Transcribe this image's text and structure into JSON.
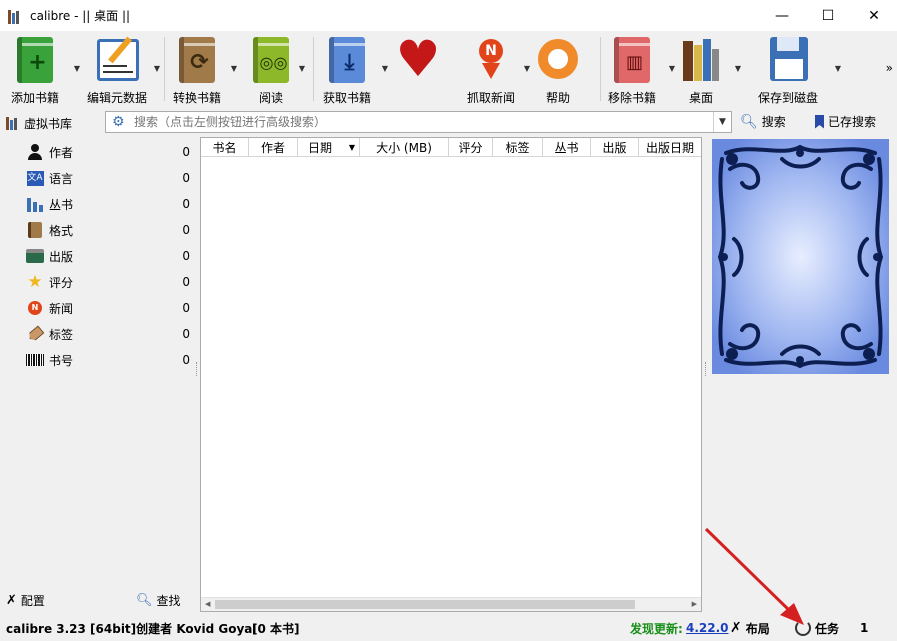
{
  "window": {
    "title": "calibre - || 桌面 ||",
    "controls": [
      "—",
      "☐",
      "✕"
    ]
  },
  "toolbar": {
    "items": [
      {
        "label": "添加书籍",
        "icon": "add-book-icon",
        "color": "#3aa23a",
        "glyph": "+"
      },
      {
        "label": "编辑元数据",
        "icon": "edit-metadata-icon",
        "color": "#3b6fb6",
        "glyph": "✎"
      },
      {
        "label": "转换书籍",
        "icon": "convert-book-icon",
        "color": "#8a6a3a",
        "glyph": "⟳"
      },
      {
        "label": "阅读",
        "icon": "read-book-icon",
        "color": "#7fb02a",
        "glyph": "∞"
      },
      {
        "label": "获取书籍",
        "icon": "get-books-icon",
        "color": "#4a7fd0",
        "glyph": "⤓"
      },
      {
        "label": "",
        "icon": "heart-icon",
        "color": "#c41818",
        "glyph": "♥"
      },
      {
        "label": "抓取新闻",
        "icon": "fetch-news-icon",
        "color": "#e04418",
        "glyph": "N"
      },
      {
        "label": "帮助",
        "icon": "help-icon",
        "color": "#f08a2a",
        "glyph": "◎"
      },
      {
        "label": "移除书籍",
        "icon": "remove-book-icon",
        "color": "#d84848",
        "glyph": "🗑"
      },
      {
        "label": "桌面",
        "icon": "library-icon",
        "color": "#8a4a2a",
        "glyph": "▮"
      },
      {
        "label": "保存到磁盘",
        "icon": "save-disk-icon",
        "color": "#3b6fb6",
        "glyph": "💾"
      }
    ],
    "more": "»"
  },
  "searchbar": {
    "virtual_library": "虚拟书库",
    "placeholder": "搜索（点击左侧按钮进行高级搜索）",
    "search_button": "搜索",
    "saved_search_button": "已存搜索"
  },
  "tag_browser": {
    "items": [
      {
        "label": "作者",
        "count": "0",
        "icon": "author-icon"
      },
      {
        "label": "语言",
        "count": "0",
        "icon": "language-icon"
      },
      {
        "label": "丛书",
        "count": "0",
        "icon": "series-icon"
      },
      {
        "label": "格式",
        "count": "0",
        "icon": "format-icon"
      },
      {
        "label": "出版",
        "count": "0",
        "icon": "publisher-icon"
      },
      {
        "label": "评分",
        "count": "0",
        "icon": "rating-icon"
      },
      {
        "label": "新闻",
        "count": "0",
        "icon": "news-icon"
      },
      {
        "label": "标签",
        "count": "0",
        "icon": "tag-icon"
      },
      {
        "label": "书号",
        "count": "0",
        "icon": "identifier-icon"
      }
    ],
    "configure": "配置",
    "find": "查找"
  },
  "book_list": {
    "columns": [
      "书名",
      "作者",
      "日期",
      "大小 (MB)",
      "评分",
      "标签",
      "丛书",
      "出版",
      "出版日期"
    ]
  },
  "statusbar": {
    "version": "calibre 3.23 [64bit]创建者 Kovid Goyal",
    "book_count": "[0 本书]",
    "update_label": "发现更新:",
    "update_version": "4.22.0",
    "layout": "布局",
    "jobs": "任务",
    "jobs_count": "1"
  },
  "colors": {
    "accent": "#3b6fb6",
    "update_green": "#1a8f1a",
    "link_blue": "#1a3fbf",
    "cover_blue": "#7e9ee8",
    "arrow_red": "#d42020"
  }
}
